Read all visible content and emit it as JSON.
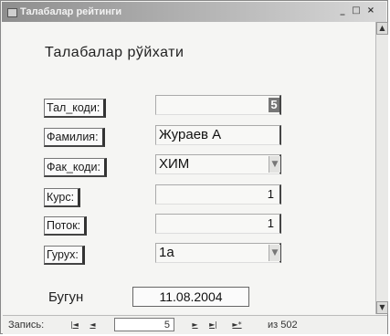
{
  "window": {
    "title": "Талабалар рейтинги",
    "min_glyph": "_",
    "max_glyph": "□",
    "close_glyph": "×"
  },
  "form": {
    "title": "Талабалар рўйхати",
    "fields": [
      {
        "label": "Тал_коди:",
        "value": "5",
        "kind": "number-badge"
      },
      {
        "label": "Фамилия:",
        "value": "Жураев А",
        "kind": "text"
      },
      {
        "label": "Фак_коди:",
        "value": "ХИМ",
        "kind": "combo"
      },
      {
        "label": "Курс:",
        "value": "1",
        "kind": "number"
      },
      {
        "label": "Поток:",
        "value": "1",
        "kind": "number"
      },
      {
        "label": "Гурух:",
        "value": "1а",
        "kind": "combo"
      }
    ],
    "today_label": "Бугун",
    "today_value": "11.08.2004"
  },
  "navigation": {
    "record_label": "Запись:",
    "first_glyph": "|◄",
    "prev_glyph": "◄",
    "current_record": "5",
    "next_glyph": "►",
    "last_glyph": "►|",
    "new_glyph": "►*",
    "of_text": "из 502"
  },
  "icons": {
    "scroll_up": "scroll-up-icon",
    "scroll_down": "scroll-down-icon",
    "dropdown": "chevron-down-icon"
  }
}
